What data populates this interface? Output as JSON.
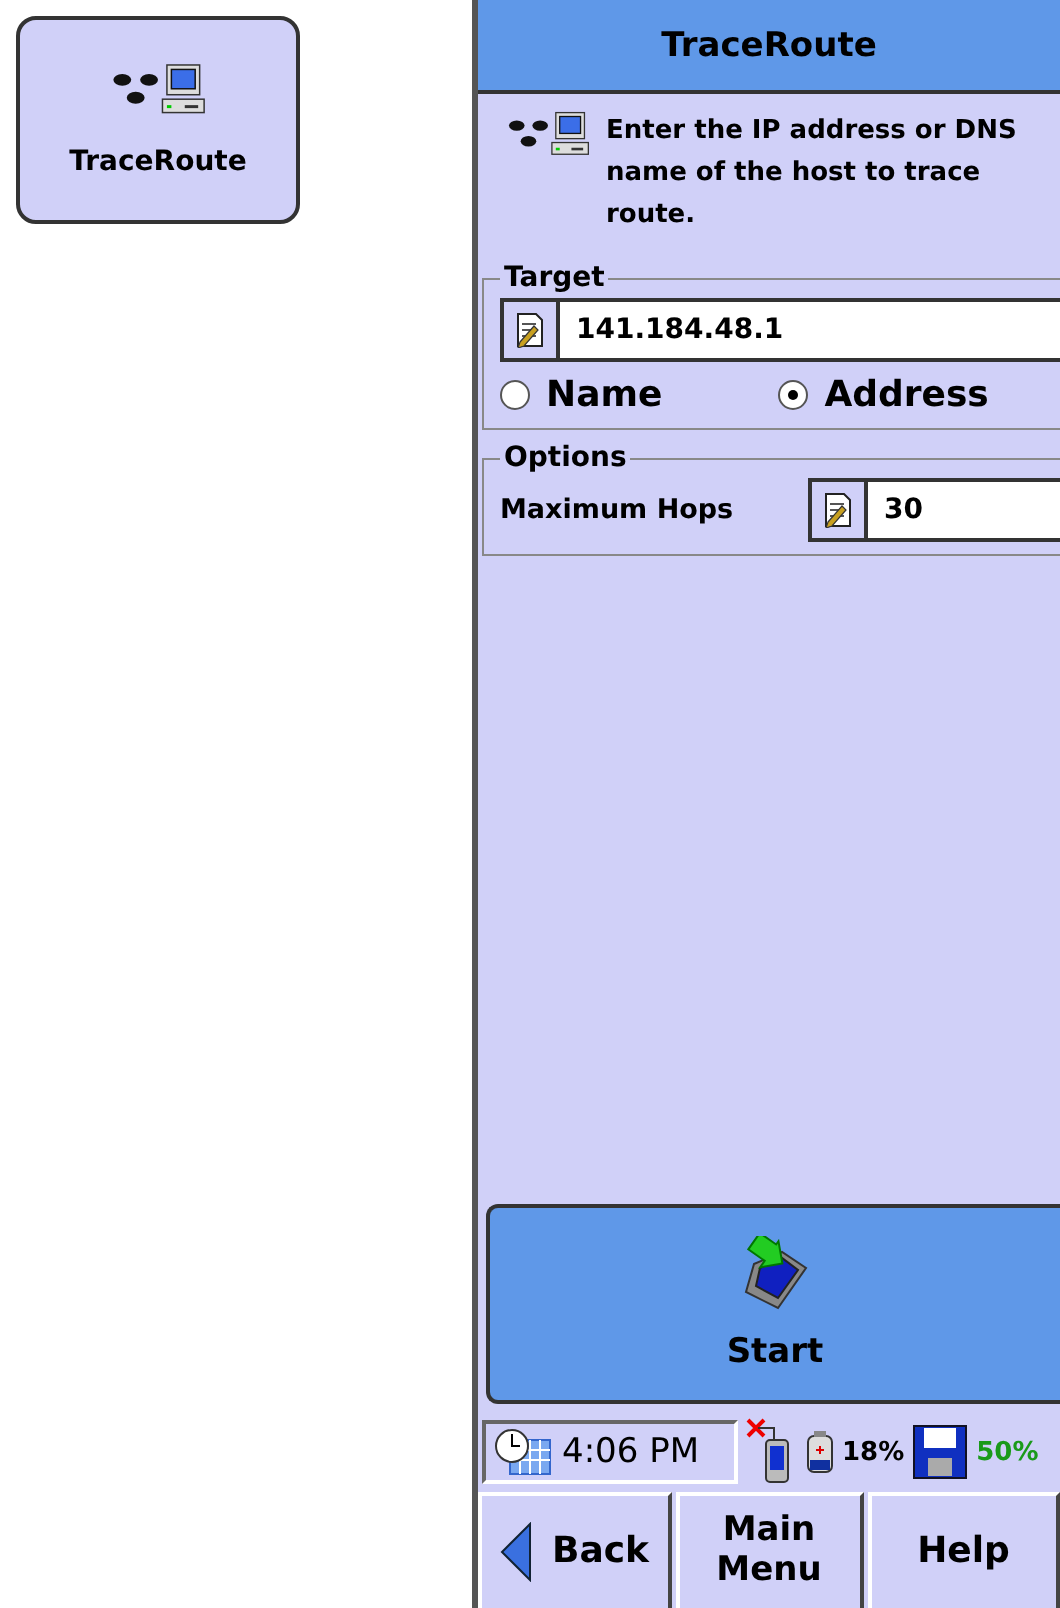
{
  "launcher_tile": {
    "label": "TraceRoute"
  },
  "window": {
    "title": "TraceRoute"
  },
  "intro": "Enter the IP address or DNS name of the host to trace route.",
  "target": {
    "legend": "Target",
    "value": "141.184.48.1",
    "options": [
      {
        "label": "Name",
        "selected": false
      },
      {
        "label": "Address",
        "selected": true
      }
    ]
  },
  "options_group": {
    "legend": "Options",
    "label": "Maximum Hops",
    "value": "30"
  },
  "start_button": {
    "label": "Start"
  },
  "status_bar": {
    "time": "4:06 PM",
    "battery": "18%",
    "storage": "50%"
  },
  "buttons": [
    {
      "kind": "back",
      "label": "Back"
    },
    {
      "kind": "plain",
      "label": "Main Menu"
    },
    {
      "kind": "plain",
      "label": "Help"
    }
  ]
}
